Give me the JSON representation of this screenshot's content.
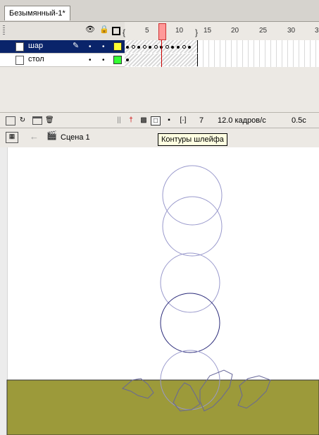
{
  "document_tab": {
    "title": "Безымянный-1*"
  },
  "timeline": {
    "ruler_labels": [
      "5",
      "10",
      "15",
      "20",
      "25",
      "30",
      "3"
    ],
    "layers": [
      {
        "name": "шар",
        "selected": true,
        "color": "#ffff33"
      },
      {
        "name": "стол",
        "selected": false,
        "color": "#33ff33"
      }
    ],
    "status": {
      "current_frame": "7",
      "fps": "12.0 кадров/с",
      "time": "0.5с"
    },
    "tooltip": "Контуры шлейфа"
  },
  "editbar": {
    "scene": "Сцена 1"
  },
  "stage": {
    "table_color": "#9c9a3a",
    "onion_color": "#9999cc",
    "current_color": "#2b2b7a"
  }
}
